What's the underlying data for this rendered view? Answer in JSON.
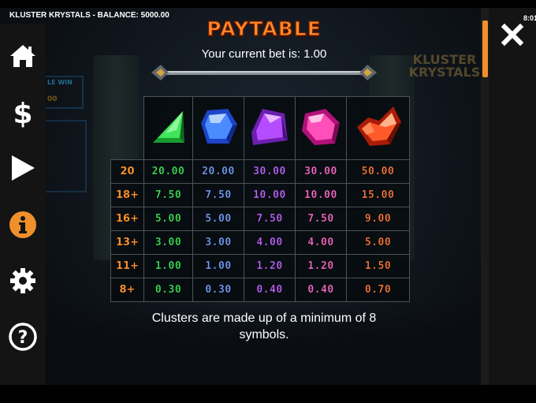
{
  "window": {
    "title": "KLUSTER KRYSTALS - BALANCE: 5000.00",
    "clock": "8:01"
  },
  "background": {
    "logo_text": "KLUSTER KRYSTALS",
    "panel_tag_1": "LE WIN",
    "panel_tag_2": "00"
  },
  "sidebar": {
    "items": [
      {
        "name": "home",
        "icon": "home-icon"
      },
      {
        "name": "bet",
        "icon": "dollar-icon"
      },
      {
        "name": "play",
        "icon": "play-icon"
      },
      {
        "name": "info",
        "icon": "info-icon",
        "active": true
      },
      {
        "name": "settings",
        "icon": "gear-icon"
      },
      {
        "name": "help",
        "icon": "question-icon"
      }
    ],
    "active_color": "#f0902a"
  },
  "paytable": {
    "title": "PAYTABLE",
    "bet_line": "Your current bet is: 1.00",
    "symbols": [
      {
        "name": "green-gem",
        "color": "#2fd94a"
      },
      {
        "name": "blue-gem",
        "color": "#4a8cff"
      },
      {
        "name": "purple-gem",
        "color": "#b64cff"
      },
      {
        "name": "pink-gem",
        "color": "#ff4fb8"
      },
      {
        "name": "red-gem",
        "color": "#ff5a2a"
      }
    ],
    "rows": [
      {
        "size": "20",
        "values": [
          "20.00",
          "20.00",
          "30.00",
          "30.00",
          "50.00"
        ]
      },
      {
        "size": "18+",
        "values": [
          "7.50",
          "7.50",
          "10.00",
          "10.00",
          "15.00"
        ]
      },
      {
        "size": "16+",
        "values": [
          "5.00",
          "5.00",
          "7.50",
          "7.50",
          "9.00"
        ]
      },
      {
        "size": "13+",
        "values": [
          "3.00",
          "3.00",
          "4.00",
          "4.00",
          "5.00"
        ]
      },
      {
        "size": "11+",
        "values": [
          "1.00",
          "1.00",
          "1.20",
          "1.20",
          "1.50"
        ]
      },
      {
        "size": "8+",
        "values": [
          "0.30",
          "0.30",
          "0.40",
          "0.40",
          "0.70"
        ]
      }
    ],
    "value_colors": [
      "#3fe55a",
      "#7aa2ff",
      "#c266ff",
      "#ff6ccb",
      "#ff7a3a"
    ],
    "footnote": "Clusters are made up of a minimum of 8 symbols."
  },
  "scrollbar": {
    "color": "#f0902a"
  },
  "close_icon": "close-icon"
}
